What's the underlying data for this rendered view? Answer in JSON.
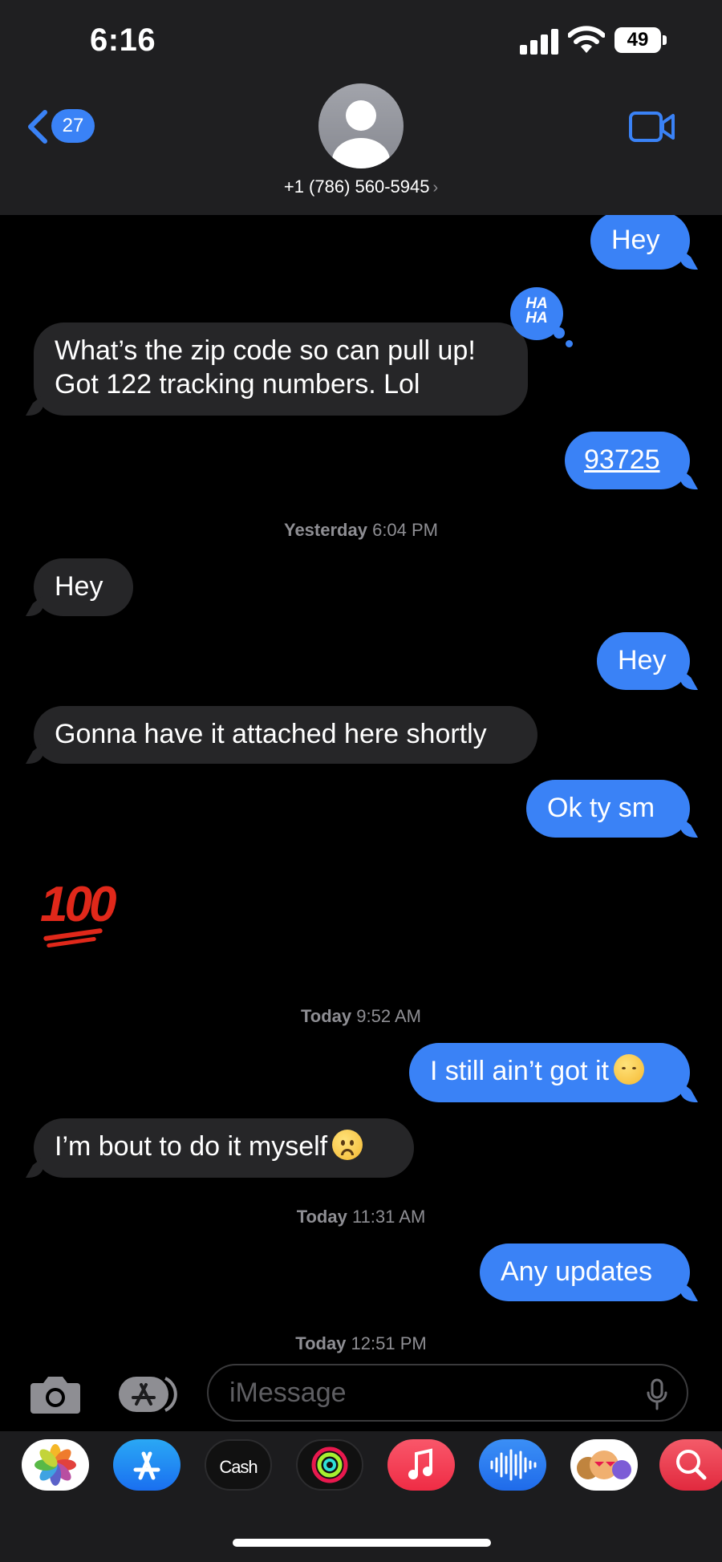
{
  "status_bar": {
    "time": "6:16",
    "battery": "49"
  },
  "header": {
    "back_count": "27",
    "contact": "+1 (786) 560-5945",
    "contact_chevron": "›"
  },
  "messages": {
    "m1": "Hey",
    "reaction": "HA HA",
    "m2_line1": "What’s the zip code so can pull up!",
    "m2_line2": "Got 122 tracking numbers. Lol",
    "m3": "93725",
    "ts1_day": "Yesterday",
    "ts1_time": "6:04 PM",
    "m4": "Hey",
    "m5": "Hey",
    "m6": "Gonna have it attached here shortly",
    "m7": "Ok ty sm",
    "m8_emoji": "100",
    "ts2_day": "Today",
    "ts2_time": "9:52 AM",
    "m9": "I still ain’t got it",
    "m10": "I’m bout to do it myself",
    "ts3_day": "Today",
    "ts3_time": "11:31 AM",
    "m11": "Any updates",
    "ts4_day": "Today",
    "ts4_time": "12:51 PM"
  },
  "compose": {
    "placeholder": "iMessage"
  },
  "apps": [
    {
      "icon": "photos-icon"
    },
    {
      "icon": "app-store-icon"
    },
    {
      "icon": "apple-cash-icon",
      "label": "Cash"
    },
    {
      "icon": "activity-icon"
    },
    {
      "icon": "music-icon"
    },
    {
      "icon": "voice-memo-icon"
    },
    {
      "icon": "memoji-icon"
    },
    {
      "icon": "search-images-icon"
    }
  ],
  "colors": {
    "outgoing": "#3a82f6",
    "incoming": "#262628",
    "header": "#1f1f21",
    "hundred": "#e0281a"
  }
}
